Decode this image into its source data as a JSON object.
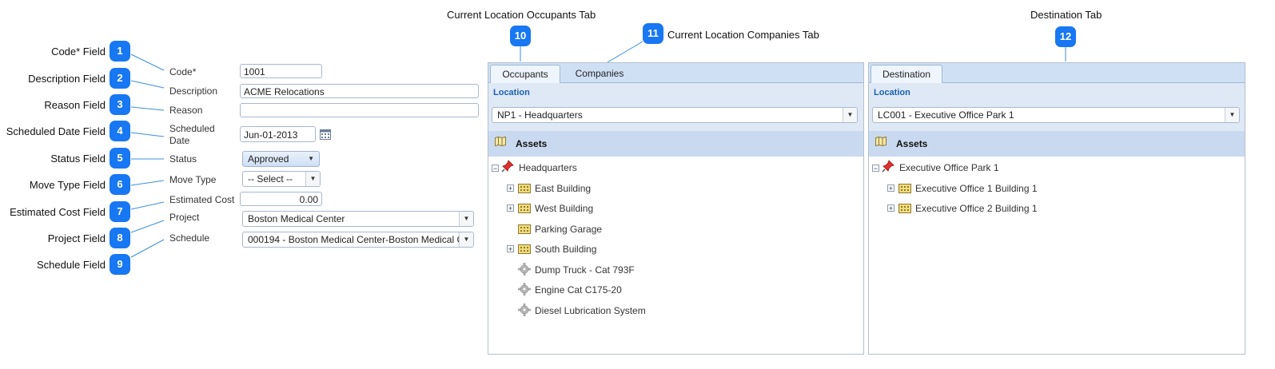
{
  "callouts": [
    {
      "num": "1",
      "label": "Code* Field"
    },
    {
      "num": "2",
      "label": "Description Field"
    },
    {
      "num": "3",
      "label": "Reason Field"
    },
    {
      "num": "4",
      "label": "Scheduled Date Field"
    },
    {
      "num": "5",
      "label": "Status Field"
    },
    {
      "num": "6",
      "label": "Move Type Field"
    },
    {
      "num": "7",
      "label": "Estimated Cost Field"
    },
    {
      "num": "8",
      "label": "Project Field"
    },
    {
      "num": "9",
      "label": "Schedule Field"
    },
    {
      "num": "10",
      "label": "Current Location Occupants Tab"
    },
    {
      "num": "11",
      "label": "Current Location Companies Tab"
    },
    {
      "num": "12",
      "label": "Destination Tab"
    }
  ],
  "form": {
    "code": {
      "label": "Code*",
      "value": "1001"
    },
    "description": {
      "label": "Description",
      "value": "ACME Relocations"
    },
    "reason": {
      "label": "Reason",
      "value": ""
    },
    "scheduled_date": {
      "label_line1": "Scheduled",
      "label_line2": "Date",
      "value": "Jun-01-2013"
    },
    "status": {
      "label": "Status",
      "value": "Approved"
    },
    "move_type": {
      "label": "Move Type",
      "value": "-- Select --"
    },
    "estimated_cost": {
      "label": "Estimated Cost",
      "value": "0.00"
    },
    "project": {
      "label": "Project",
      "value": "Boston Medical Center"
    },
    "schedule": {
      "label": "Schedule",
      "value": "000194 - Boston Medical Center-Boston Medical C"
    }
  },
  "current_panel": {
    "tabs": [
      "Occupants",
      "Companies"
    ],
    "location_label": "Location",
    "location_value": "NP1 - Headquarters",
    "assets_label": "Assets",
    "tree": {
      "root": "Headquarters",
      "items": [
        "East Building",
        "West Building",
        "Parking Garage",
        "South Building",
        "Dump Truck - Cat 793F",
        "Engine Cat C175-20",
        "Diesel Lubrication System"
      ]
    }
  },
  "destination_panel": {
    "tabs": [
      "Destination"
    ],
    "location_label": "Location",
    "location_value": "LC001 - Executive Office Park 1",
    "assets_label": "Assets",
    "tree": {
      "root": "Executive Office Park 1",
      "items": [
        "Executive Office 1 Building 1",
        "Executive Office 2 Building 1"
      ]
    }
  },
  "colors": {
    "badge": "#1877f2",
    "tab_bar": "#cfe0f5",
    "section_title": "#1a5fb4",
    "callout_line": "#3b8fe0"
  },
  "icons": {
    "calendar": "calendar-icon",
    "building": "building-icon",
    "pin": "pushpin-icon",
    "gear": "gear-icon",
    "map": "map-icon"
  }
}
